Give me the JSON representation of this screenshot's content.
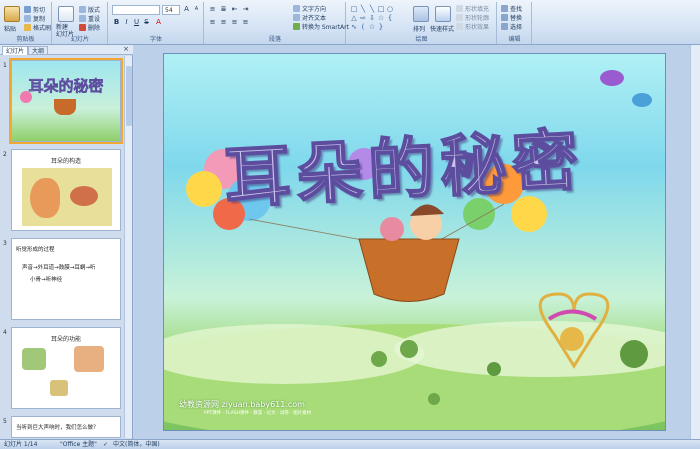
{
  "ribbon": {
    "clipboard": {
      "label": "剪贴板",
      "paste": "粘贴",
      "cut": "剪切",
      "copy": "复制",
      "format_painter": "格式刷"
    },
    "slides": {
      "label": "幻灯片",
      "new_slide": "新建\n幻灯片",
      "layout": "版式",
      "reset": "重设",
      "delete": "删除"
    },
    "font": {
      "label": "字体",
      "font_name": "",
      "font_size": "54"
    },
    "paragraph": {
      "label": "段落",
      "text_direction": "文字方向",
      "align_text": "对齐文本",
      "smartart": "转换为 SmartArt"
    },
    "drawing": {
      "label": "绘图",
      "arrange": "排列",
      "quick_styles": "快速样式",
      "shape_fill": "形状填充",
      "shape_outline": "形状轮廓",
      "shape_effects": "形状效果"
    },
    "editing": {
      "label": "编辑",
      "find": "查找",
      "replace": "替换",
      "select": "选择"
    }
  },
  "panel": {
    "tab_slides": "幻灯片",
    "tab_outline": "大纲",
    "close": "×",
    "thumbs": [
      {
        "num": "1",
        "title": "耳朵的秘密"
      },
      {
        "num": "2",
        "title": "耳朵的构造"
      },
      {
        "num": "3",
        "lines": [
          "听觉形成的过程",
          "声音→外耳道→鼓膜→耳蜗→听",
          "小骨→听神经"
        ]
      },
      {
        "num": "4",
        "title": "耳朵的功能"
      },
      {
        "num": "5",
        "lines": [
          "当听到巨大声响时，我们怎么做？"
        ]
      }
    ]
  },
  "slide": {
    "title": "耳朵的秘密",
    "watermark": "幼教资源网 ziyuan.baby611.com",
    "watermark_sub": "PPT课件 · FLASH课件 · 教案 · 论文 · 试卷 · 图片素材"
  },
  "status": {
    "slide_info": "幻灯片 1/14",
    "theme": "\"Office 主题\"",
    "language": "中文(简体，中国)"
  }
}
